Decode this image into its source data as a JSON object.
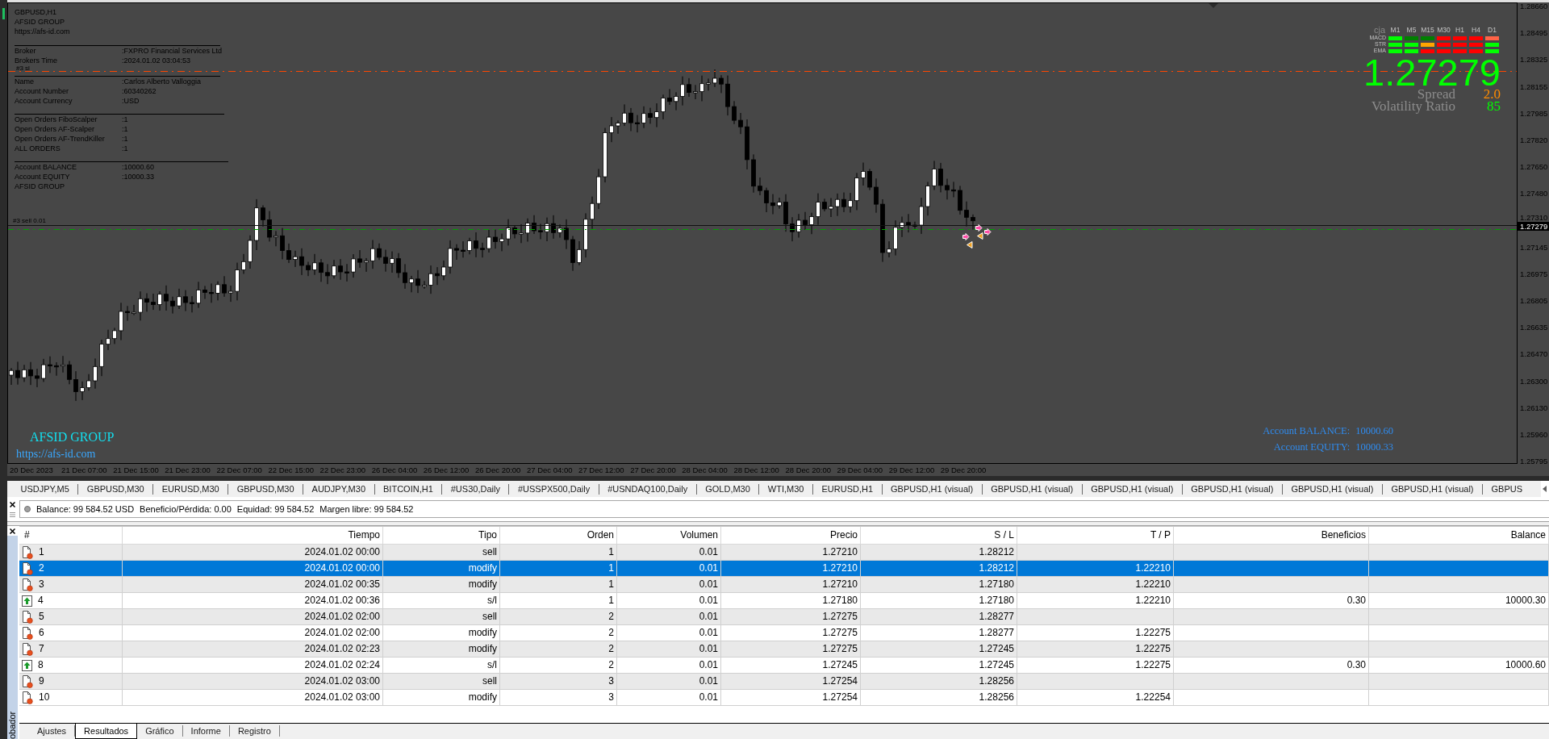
{
  "chart": {
    "info_panel": {
      "header": [
        "GBPUSD,H1",
        "AFSID GROUP",
        "https://afs-id.com"
      ],
      "sections": [
        {
          "rows": [
            {
              "label": "Broker",
              "value": ":FXPRO Financial Services Ltd"
            },
            {
              "label": "Brokers Time",
              "value": ":2024.01.02 03:04:53"
            }
          ]
        },
        {
          "rows": [
            {
              "label": "Name",
              "value": ":Carlos Alberto Valloggia"
            },
            {
              "label": "Account Number",
              "value": ":60340262"
            },
            {
              "label": "Account Currency",
              "value": ":USD"
            }
          ]
        },
        {
          "rows": [
            {
              "label": "Open Orders FiboScalper",
              "value": ":1"
            },
            {
              "label": "Open Orders AF-Scalper",
              "value": ":1"
            },
            {
              "label": "Open Orders AF-TrendKiller",
              "value": ":1"
            },
            {
              "label": "ALL ORDERS",
              "value": ":1"
            }
          ]
        },
        {
          "rows": [
            {
              "label": "Account BALANCE",
              "value": ":10000.60"
            },
            {
              "label": "Account EQUITY",
              "value": ":10000.33"
            }
          ]
        }
      ],
      "footer": "AFSID GROUP"
    },
    "indicator_panel": {
      "corner": "cja",
      "timeframes": [
        "M1",
        "M5",
        "M15",
        "M30",
        "H1",
        "H4",
        "D1"
      ],
      "rows": [
        {
          "label": "MACD",
          "cells": [
            {
              "color": "#00ff00"
            },
            {
              "color": "#008000"
            },
            {
              "color": "#008000"
            },
            {
              "color": "#ff0000"
            },
            {
              "color": "#ff0000"
            },
            {
              "color": "#ff0000"
            },
            {
              "color": "#ff6347"
            }
          ]
        },
        {
          "label": "STR",
          "cells": [
            {
              "color": "#00ff00"
            },
            {
              "color": "#00ff00"
            },
            {
              "color": "#ffa500"
            },
            {
              "color": "#ff0000"
            },
            {
              "color": "#ff0000"
            },
            {
              "color": "#ff0000"
            },
            {
              "color": "#00ff00"
            }
          ]
        },
        {
          "label": "EMA",
          "cells": [
            {
              "color": "#00ff00"
            },
            {
              "color": "#00ff00"
            },
            {
              "color": "#ff0000"
            },
            {
              "color": "#ff0000"
            },
            {
              "color": "#ff0000"
            },
            {
              "color": "#ff0000"
            },
            {
              "color": "#00ff00"
            }
          ]
        }
      ]
    },
    "quote": {
      "price": "1.27279",
      "stats": [
        {
          "label": "Spread",
          "value": "2.0",
          "color": "#ff8c00"
        },
        {
          "label": "Volatility Ratio",
          "value": "85",
          "color": "#00ff00"
        }
      ]
    },
    "lines": [
      {
        "kind": "stop_loss",
        "label": "#3 sl"
      },
      {
        "kind": "order",
        "label": "#3 sell 0.01"
      }
    ],
    "brand": {
      "name": "AFSID GROUP",
      "url": "https://afs-id.com"
    },
    "account": [
      {
        "label": "Account BALANCE:",
        "value": "10000.60"
      },
      {
        "label": "Account EQUITY:",
        "value": "10000.33"
      }
    ],
    "price_axis": [
      "1.28660",
      "1.28495",
      "1.28325",
      "1.28155",
      "1.27985",
      "1.27820",
      "1.27650",
      "1.27480",
      "1.27310",
      "1.27145",
      "1.26975",
      "1.26805",
      "1.26635",
      "1.26470",
      "1.26300",
      "1.26130",
      "1.25960",
      "1.25795"
    ],
    "current_price": "1.27279",
    "time_axis": [
      "20 Dec 2023",
      "21 Dec 07:00",
      "21 Dec 15:00",
      "21 Dec 23:00",
      "22 Dec 07:00",
      "22 Dec 15:00",
      "22 Dec 23:00",
      "26 Dec 04:00",
      "26 Dec 12:00",
      "26 Dec 20:00",
      "27 Dec 04:00",
      "27 Dec 12:00",
      "27 Dec 20:00",
      "28 Dec 04:00",
      "28 Dec 12:00",
      "28 Dec 20:00",
      "29 Dec 04:00",
      "29 Dec 12:00",
      "29 Dec 20:00"
    ]
  },
  "chart_tabs": [
    {
      "label": "USDJPY,M5",
      "selected": false
    },
    {
      "label": "GBPUSD,M30",
      "selected": false
    },
    {
      "label": "EURUSD,M30",
      "selected": false
    },
    {
      "label": "GBPUSD,M30",
      "selected": false
    },
    {
      "label": "AUDJPY,M30",
      "selected": false
    },
    {
      "label": "BITCOIN,H1",
      "selected": false
    },
    {
      "label": "#US30,Daily",
      "selected": false
    },
    {
      "label": "#USSPX500,Daily",
      "selected": false
    },
    {
      "label": "#USNDAQ100,Daily",
      "selected": false
    },
    {
      "label": "GOLD,M30",
      "selected": false
    },
    {
      "label": "WTI,M30",
      "selected": false
    },
    {
      "label": "EURUSD,H1",
      "selected": false
    },
    {
      "label": "GBPUSD,H1 (visual)",
      "selected": false
    },
    {
      "label": "GBPUSD,H1 (visual)",
      "selected": false
    },
    {
      "label": "GBPUSD,H1 (visual)",
      "selected": false
    },
    {
      "label": "GBPUSD,H1 (visual)",
      "selected": false
    },
    {
      "label": "GBPUSD,H1 (visual)",
      "selected": false
    },
    {
      "label": "GBPUSD,H1 (visual)",
      "selected": false
    },
    {
      "label": "GBPUS",
      "selected": false
    }
  ],
  "account_summary": [
    "Balance: 99 584.52 USD",
    "Beneficio/Pérdida: 0.00",
    "Equidad: 99 584.52",
    "Margen libre: 99 584.52"
  ],
  "tester": {
    "columns": [
      "#",
      "Tiempo",
      "Tipo",
      "Orden",
      "Volumen",
      "Precio",
      "S / L",
      "T / P",
      "Beneficios",
      "Balance"
    ],
    "rows": [
      {
        "kind": "order",
        "selected": false,
        "number": "1",
        "time": "2024.01.02 00:00",
        "type": "sell",
        "order": "1",
        "volume": "0.01",
        "price": "1.27210",
        "sl": "1.28212"
      },
      {
        "kind": "order",
        "selected": true,
        "number": "2",
        "time": "2024.01.02 00:00",
        "type": "modify",
        "order": "1",
        "volume": "0.01",
        "price": "1.27210",
        "sl": "1.28212",
        "tp": "1.22210"
      },
      {
        "kind": "order",
        "selected": false,
        "number": "3",
        "time": "2024.01.02 00:35",
        "type": "modify",
        "order": "1",
        "volume": "0.01",
        "price": "1.27210",
        "sl": "1.27180",
        "tp": "1.22210"
      },
      {
        "kind": "profit",
        "selected": false,
        "number": "4",
        "time": "2024.01.02 00:36",
        "type": "s/l",
        "order": "1",
        "volume": "0.01",
        "price": "1.27180",
        "sl": "1.27180",
        "tp": "1.22210",
        "profit": "0.30",
        "balance": "10000.30"
      },
      {
        "kind": "order",
        "selected": false,
        "number": "5",
        "time": "2024.01.02 02:00",
        "type": "sell",
        "order": "2",
        "volume": "0.01",
        "price": "1.27275",
        "sl": "1.28277"
      },
      {
        "kind": "order",
        "selected": false,
        "number": "6",
        "time": "2024.01.02 02:00",
        "type": "modify",
        "order": "2",
        "volume": "0.01",
        "price": "1.27275",
        "sl": "1.28277",
        "tp": "1.22275"
      },
      {
        "kind": "order",
        "selected": false,
        "number": "7",
        "time": "2024.01.02 02:23",
        "type": "modify",
        "order": "2",
        "volume": "0.01",
        "price": "1.27275",
        "sl": "1.27245",
        "tp": "1.22275"
      },
      {
        "kind": "profit",
        "selected": false,
        "number": "8",
        "time": "2024.01.02 02:24",
        "type": "s/l",
        "order": "2",
        "volume": "0.01",
        "price": "1.27245",
        "sl": "1.27245",
        "tp": "1.22275",
        "profit": "0.30",
        "balance": "10000.60"
      },
      {
        "kind": "order",
        "selected": false,
        "number": "9",
        "time": "2024.01.02 03:00",
        "type": "sell",
        "order": "3",
        "volume": "0.01",
        "price": "1.27254",
        "sl": "1.28256"
      },
      {
        "kind": "order",
        "selected": false,
        "number": "10",
        "time": "2024.01.02 03:00",
        "type": "modify",
        "order": "3",
        "volume": "0.01",
        "price": "1.27254",
        "sl": "1.28256",
        "tp": "1.22254"
      }
    ]
  },
  "bottom_tabs": [
    {
      "label": "Ajustes",
      "selected": false
    },
    {
      "label": "Resultados",
      "selected": true
    },
    {
      "label": "Gráfico",
      "selected": false
    },
    {
      "label": "Informe",
      "selected": false
    },
    {
      "label": "Registro",
      "selected": false
    }
  ],
  "panel_title": "obador"
}
